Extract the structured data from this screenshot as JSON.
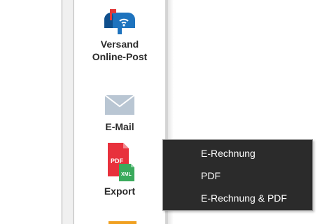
{
  "toolbar": {
    "online_post": {
      "label_line1": "Versand",
      "label_line2": "Online-Post",
      "icon": "mailbox-icon"
    },
    "email": {
      "label": "E-Mail",
      "icon": "envelope-icon"
    },
    "export": {
      "label": "Export",
      "icon": "pdf-xml-icon",
      "icon_text_pdf": "PDF",
      "icon_text_xml": "XML"
    }
  },
  "export_menu": {
    "items": [
      {
        "label": "E-Rechnung"
      },
      {
        "label": "PDF"
      },
      {
        "label": "E-Rechnung & PDF"
      }
    ]
  },
  "colors": {
    "accent_blue": "#1e73be",
    "pdf_red": "#e8313c",
    "xml_green": "#3aaa5c",
    "menu_background": "#2b2b2b",
    "menu_text": "#ffffff"
  }
}
